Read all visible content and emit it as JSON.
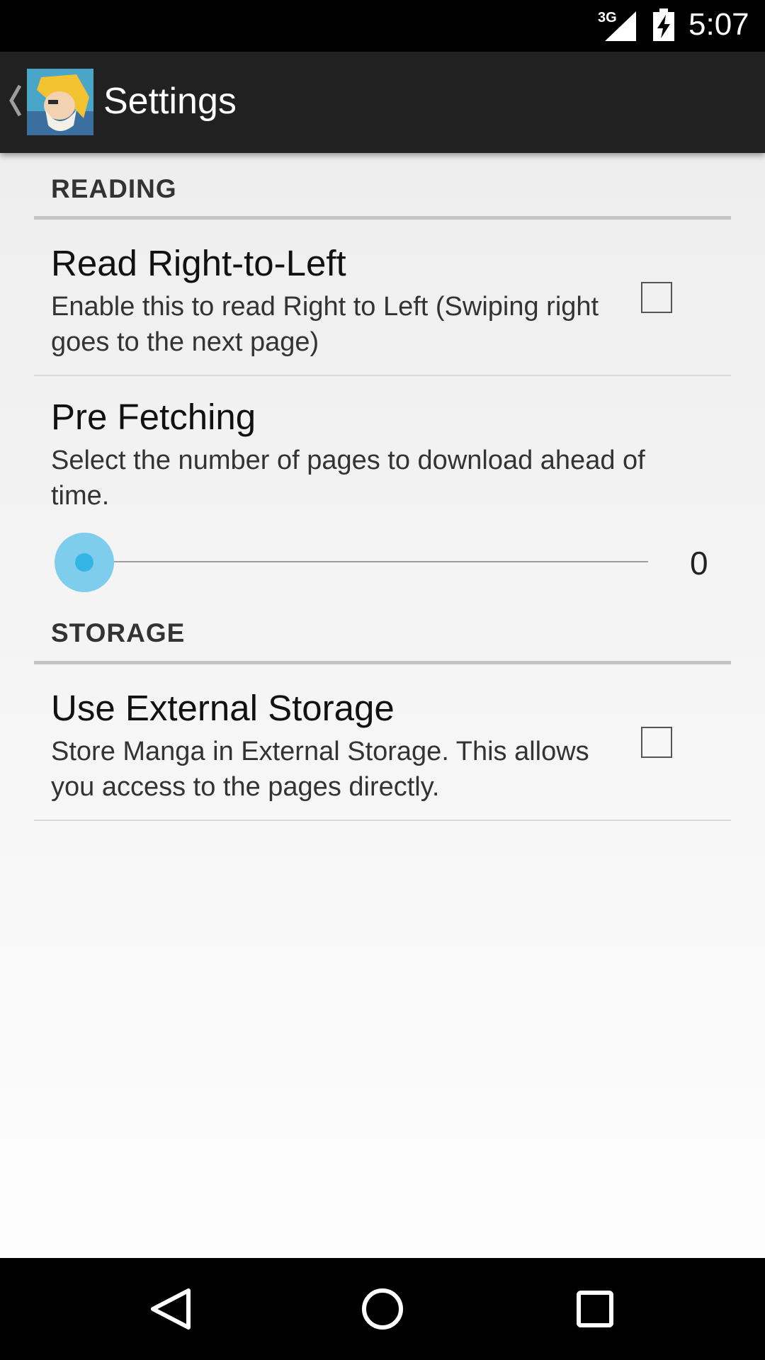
{
  "status_bar": {
    "network_type": "3G",
    "time": "5:07"
  },
  "action_bar": {
    "title": "Settings"
  },
  "sections": [
    {
      "header": "READING",
      "items": [
        {
          "title": "Read Right-to-Left",
          "summary": "Enable this to read Right to Left (Swiping right goes to the next page)",
          "checked": false
        },
        {
          "title": "Pre Fetching",
          "summary": "Select the number of pages to download ahead of time.",
          "slider_value": "0"
        }
      ]
    },
    {
      "header": "STORAGE",
      "items": [
        {
          "title": "Use External Storage",
          "summary": "Store Manga in External Storage. This allows you access to the pages directly.",
          "checked": false
        }
      ]
    }
  ],
  "colors": {
    "accent": "#33b5e5",
    "action_bar": "#212121"
  }
}
